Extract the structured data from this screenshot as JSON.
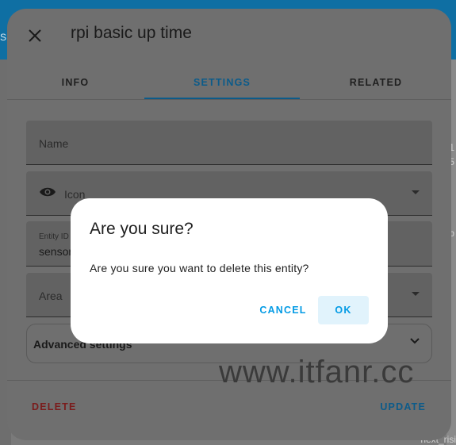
{
  "background": {
    "topbar_text": "SE",
    "right_snippets": [
      "1",
      "5",
      "b",
      "next_risi"
    ]
  },
  "dialog": {
    "title": "rpi basic up time",
    "tabs": [
      {
        "label": "INFO"
      },
      {
        "label": "SETTINGS",
        "active": true
      },
      {
        "label": "RELATED"
      }
    ],
    "fields": {
      "name_label": "Name",
      "icon_label": "Icon",
      "entity_id_label": "Entity ID",
      "entity_id_value": "sensor",
      "area_label": "Area"
    },
    "advanced_label": "Advanced settings",
    "delete_label": "DELETE",
    "update_label": "UPDATE"
  },
  "confirm": {
    "title": "Are you sure?",
    "message": "Are you sure you want to delete this entity?",
    "cancel_label": "CANCEL",
    "ok_label": "OK"
  },
  "watermark": "www.itfanr.cc",
  "colors": {
    "accent": "#039be5",
    "topbar": "#0f6fa3",
    "delete": "#7a1c1c"
  }
}
